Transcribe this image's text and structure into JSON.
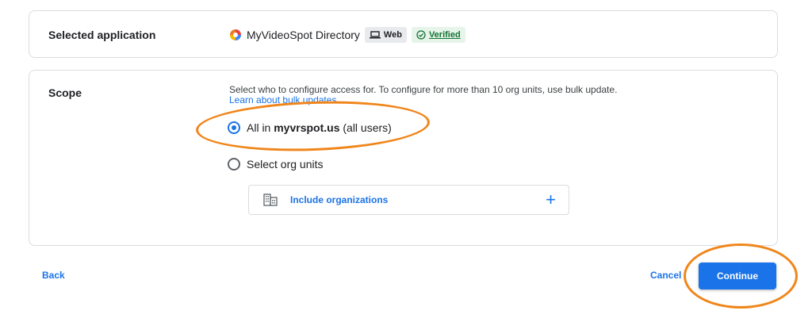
{
  "app_card": {
    "title": "Selected application",
    "app_name": "MyVideoSpot Directory",
    "web_chip": "Web",
    "verified_chip": "Verified"
  },
  "scope_card": {
    "title": "Scope",
    "description": "Select who to configure access for. To configure for more than 10 org units, use bulk update.",
    "learn_link": "Learn about bulk updates",
    "option_all_prefix": "All in ",
    "option_all_domain": "myvrspot.us",
    "option_all_suffix": " (all users)",
    "option_org": "Select org units",
    "include_label": "Include organizations",
    "include_plus": "+",
    "selected_option": "all"
  },
  "footer": {
    "back": "Back",
    "cancel": "Cancel",
    "continue": "Continue"
  },
  "colors": {
    "accent": "#1a73e8",
    "annotation": "#f08519",
    "verified": "#137333"
  },
  "icons": {
    "app_logo": "app-logo-icon",
    "web": "laptop-icon",
    "verified": "check-circle-icon",
    "include": "building-icon"
  }
}
